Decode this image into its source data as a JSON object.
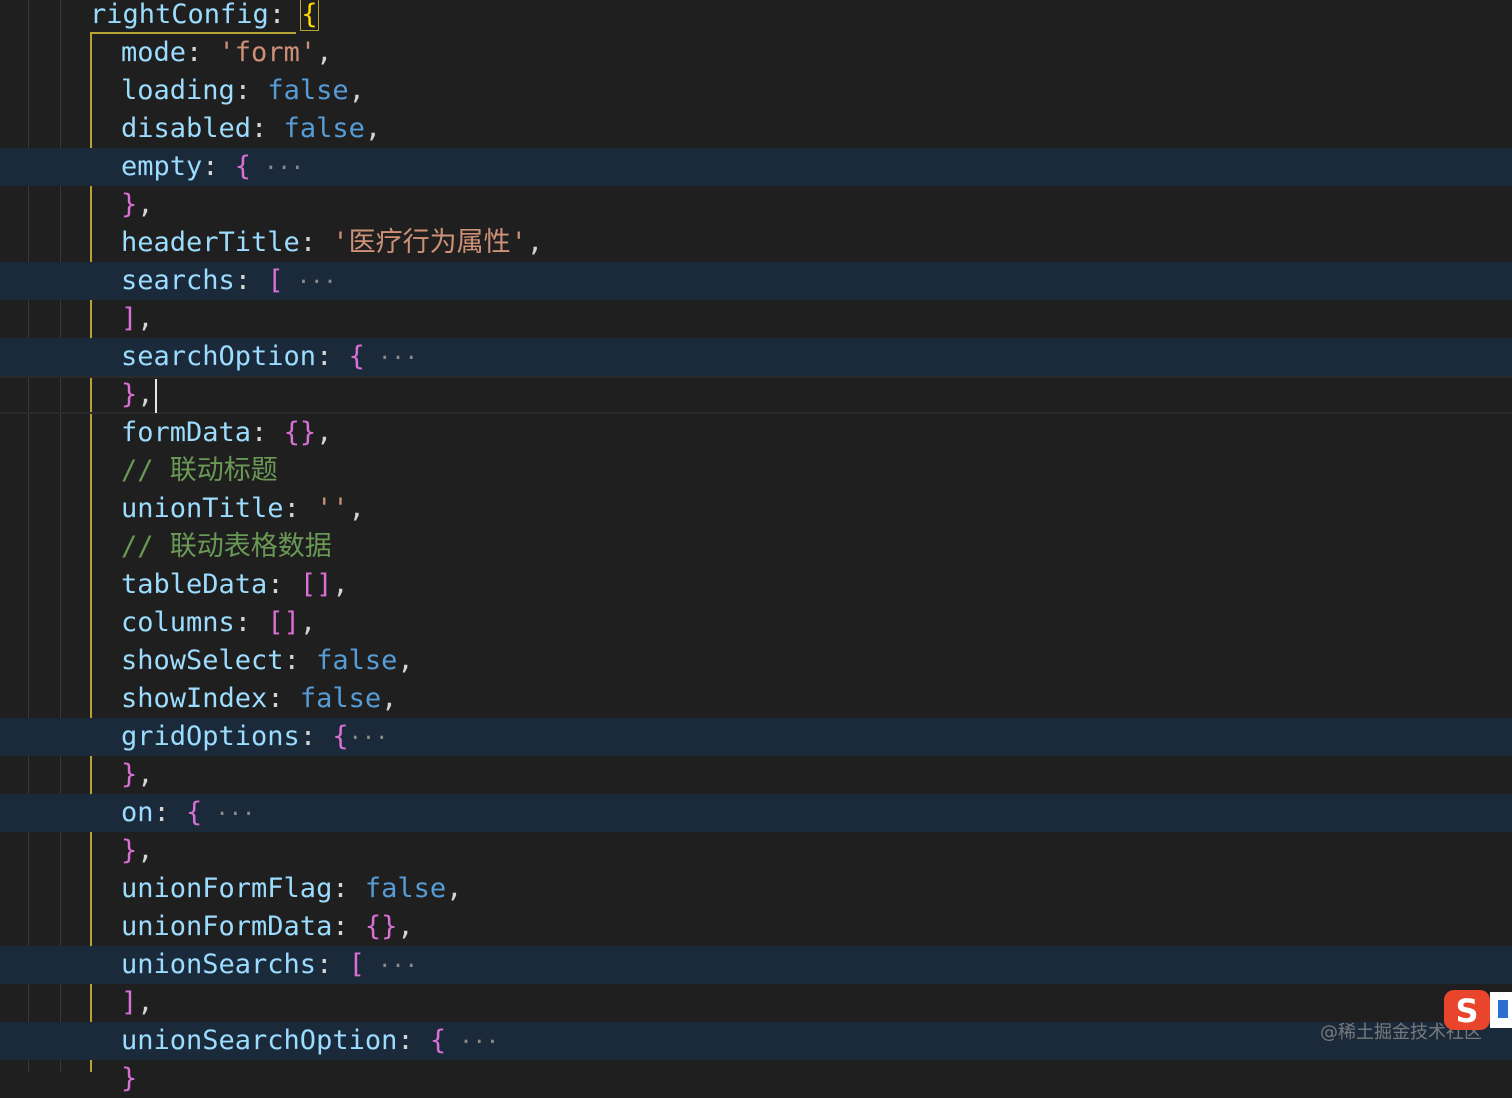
{
  "editor": {
    "lines": [
      {
        "parts": [
          {
            "t": "key",
            "v": "rightConfig"
          },
          {
            "t": "punct",
            "v": ": "
          },
          {
            "t": "brace-gold",
            "v": "{"
          }
        ],
        "top": true
      },
      {
        "parts": [
          {
            "t": "key",
            "v": "mode"
          },
          {
            "t": "punct",
            "v": ": "
          },
          {
            "t": "str",
            "v": "'form'"
          },
          {
            "t": "punct",
            "v": ","
          }
        ]
      },
      {
        "parts": [
          {
            "t": "key",
            "v": "loading"
          },
          {
            "t": "punct",
            "v": ": "
          },
          {
            "t": "kw",
            "v": "false"
          },
          {
            "t": "punct",
            "v": ","
          }
        ]
      },
      {
        "parts": [
          {
            "t": "key",
            "v": "disabled"
          },
          {
            "t": "punct",
            "v": ": "
          },
          {
            "t": "kw",
            "v": "false"
          },
          {
            "t": "punct",
            "v": ","
          }
        ]
      },
      {
        "parts": [
          {
            "t": "key",
            "v": "empty"
          },
          {
            "t": "punct",
            "v": ": "
          },
          {
            "t": "brace",
            "v": "{"
          },
          {
            "t": "dots",
            "v": " ···"
          }
        ],
        "fold": true
      },
      {
        "parts": [
          {
            "t": "brace",
            "v": "}"
          },
          {
            "t": "punct",
            "v": ","
          }
        ]
      },
      {
        "parts": [
          {
            "t": "key",
            "v": "headerTitle"
          },
          {
            "t": "punct",
            "v": ": "
          },
          {
            "t": "str",
            "v": "'医疗行为属性'"
          },
          {
            "t": "punct",
            "v": ","
          }
        ]
      },
      {
        "parts": [
          {
            "t": "key",
            "v": "searchs"
          },
          {
            "t": "punct",
            "v": ": "
          },
          {
            "t": "brace",
            "v": "["
          },
          {
            "t": "dots",
            "v": " ···"
          }
        ],
        "fold": true
      },
      {
        "parts": [
          {
            "t": "brace",
            "v": "]"
          },
          {
            "t": "punct",
            "v": ","
          }
        ]
      },
      {
        "parts": [
          {
            "t": "key",
            "v": "searchOption"
          },
          {
            "t": "punct",
            "v": ": "
          },
          {
            "t": "brace",
            "v": "{"
          },
          {
            "t": "dots",
            "v": " ···"
          }
        ],
        "fold": true
      },
      {
        "parts": [
          {
            "t": "brace",
            "v": "}"
          },
          {
            "t": "punct",
            "v": ","
          }
        ],
        "cursor": true,
        "current": true
      },
      {
        "parts": [
          {
            "t": "key",
            "v": "formData"
          },
          {
            "t": "punct",
            "v": ": "
          },
          {
            "t": "brace",
            "v": "{}"
          },
          {
            "t": "punct",
            "v": ","
          }
        ]
      },
      {
        "parts": [
          {
            "t": "comment",
            "v": "// 联动标题"
          }
        ]
      },
      {
        "parts": [
          {
            "t": "key",
            "v": "unionTitle"
          },
          {
            "t": "punct",
            "v": ": "
          },
          {
            "t": "str",
            "v": "''"
          },
          {
            "t": "punct",
            "v": ","
          }
        ]
      },
      {
        "parts": [
          {
            "t": "comment",
            "v": "// 联动表格数据"
          }
        ]
      },
      {
        "parts": [
          {
            "t": "key",
            "v": "tableData"
          },
          {
            "t": "punct",
            "v": ": "
          },
          {
            "t": "brace",
            "v": "[]"
          },
          {
            "t": "punct",
            "v": ","
          }
        ]
      },
      {
        "parts": [
          {
            "t": "key",
            "v": "columns"
          },
          {
            "t": "punct",
            "v": ": "
          },
          {
            "t": "brace",
            "v": "[]"
          },
          {
            "t": "punct",
            "v": ","
          }
        ]
      },
      {
        "parts": [
          {
            "t": "key",
            "v": "showSelect"
          },
          {
            "t": "punct",
            "v": ": "
          },
          {
            "t": "kw",
            "v": "false"
          },
          {
            "t": "punct",
            "v": ","
          }
        ]
      },
      {
        "parts": [
          {
            "t": "key",
            "v": "showIndex"
          },
          {
            "t": "punct",
            "v": ": "
          },
          {
            "t": "kw",
            "v": "false"
          },
          {
            "t": "punct",
            "v": ","
          }
        ]
      },
      {
        "parts": [
          {
            "t": "key",
            "v": "gridOptions"
          },
          {
            "t": "punct",
            "v": ": "
          },
          {
            "t": "brace",
            "v": "{"
          },
          {
            "t": "dots",
            "v": "···"
          }
        ],
        "fold": true
      },
      {
        "parts": [
          {
            "t": "brace",
            "v": "}"
          },
          {
            "t": "punct",
            "v": ","
          }
        ]
      },
      {
        "parts": [
          {
            "t": "key",
            "v": "on"
          },
          {
            "t": "punct",
            "v": ": "
          },
          {
            "t": "brace",
            "v": "{"
          },
          {
            "t": "dots",
            "v": " ···"
          }
        ],
        "fold": true
      },
      {
        "parts": [
          {
            "t": "brace",
            "v": "}"
          },
          {
            "t": "punct",
            "v": ","
          }
        ]
      },
      {
        "parts": [
          {
            "t": "key",
            "v": "unionFormFlag"
          },
          {
            "t": "punct",
            "v": ": "
          },
          {
            "t": "kw",
            "v": "false"
          },
          {
            "t": "punct",
            "v": ","
          }
        ]
      },
      {
        "parts": [
          {
            "t": "key",
            "v": "unionFormData"
          },
          {
            "t": "punct",
            "v": ": "
          },
          {
            "t": "brace",
            "v": "{}"
          },
          {
            "t": "punct",
            "v": ","
          }
        ]
      },
      {
        "parts": [
          {
            "t": "key",
            "v": "unionSearchs"
          },
          {
            "t": "punct",
            "v": ": "
          },
          {
            "t": "brace",
            "v": "["
          },
          {
            "t": "dots",
            "v": " ···"
          }
        ],
        "fold": true
      },
      {
        "parts": [
          {
            "t": "brace",
            "v": "]"
          },
          {
            "t": "punct",
            "v": ","
          }
        ]
      },
      {
        "parts": [
          {
            "t": "key",
            "v": "unionSearchOption"
          },
          {
            "t": "punct",
            "v": ": "
          },
          {
            "t": "brace",
            "v": "{"
          },
          {
            "t": "dots",
            "v": " ···"
          }
        ],
        "fold": true
      },
      {
        "parts": [
          {
            "t": "brace",
            "v": "}"
          }
        ]
      }
    ]
  },
  "watermark": "@稀土掘金技术社区",
  "ime_icon": "sogou-ime-icon",
  "colors": {
    "background": "#1f1f1f",
    "key": "#9cdcfe",
    "string": "#ce9178",
    "keyword": "#569cd6",
    "brace": "#da70d6",
    "comment": "#6a9955",
    "fold_highlight": "#1b2a3a"
  }
}
